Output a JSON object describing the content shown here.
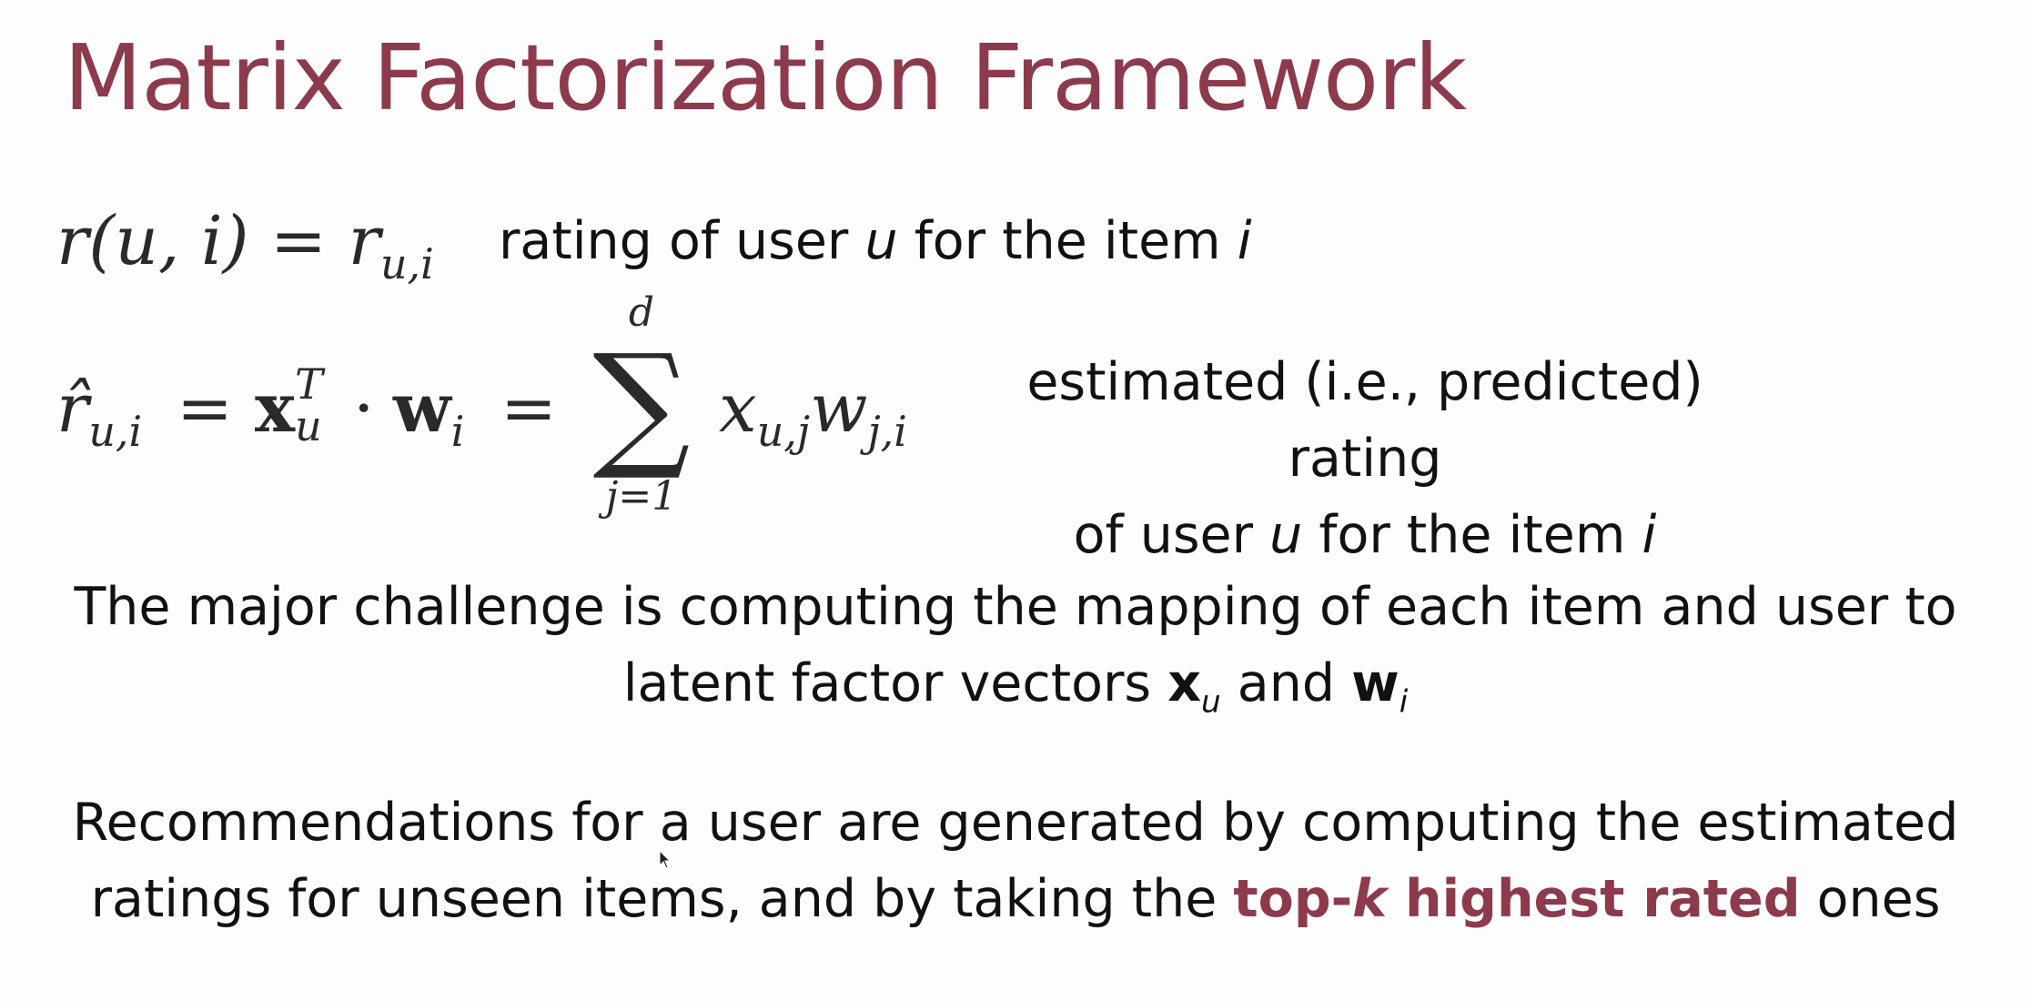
{
  "slide": {
    "title": "Matrix Factorization Framework",
    "accent_color": "#8c3a4c",
    "eq1": {
      "lhs_fn": "r",
      "lhs_args": "(u, i)",
      "equals": "=",
      "rhs_var": "r",
      "rhs_sub": "u,i"
    },
    "eq1_desc": {
      "prefix": "rating of user ",
      "user_var": "u",
      "middle": " for the item ",
      "item_var": "i"
    },
    "eq2": {
      "lhs": "r̂",
      "lhs_sub": "u,i",
      "eq_a": "=",
      "x_bold": "x",
      "x_sup": "T",
      "x_sub": "u",
      "dot": "·",
      "w_bold": "w",
      "w_sub": "i",
      "eq_b": "=",
      "sum_upper": "d",
      "sum_sign": "∑",
      "sum_lower": "j=1",
      "term_x": "x",
      "term_x_sub": "u,j",
      "term_w": "w",
      "term_w_sub": "j,i"
    },
    "eq2_desc": {
      "line1": "estimated (i.e., predicted) rating",
      "line2_prefix": "of user ",
      "user_var": "u",
      "line2_middle": " for the item ",
      "item_var": "i"
    },
    "para1": {
      "line1": "The major challenge is computing the mapping of each item and user to",
      "line2_prefix": "latent factor vectors ",
      "x_vec": "x",
      "x_sub": "u",
      "conj": " and ",
      "w_vec": "w",
      "w_sub": "i"
    },
    "para2": {
      "line1": "Recommendations for a user are generated by computing the estimated",
      "line2_prefix": "ratings for unseen items, and by taking the ",
      "hl_a": "top-",
      "hl_k": "k",
      "hl_b": " highest rated",
      "line2_suffix": " ones"
    }
  }
}
